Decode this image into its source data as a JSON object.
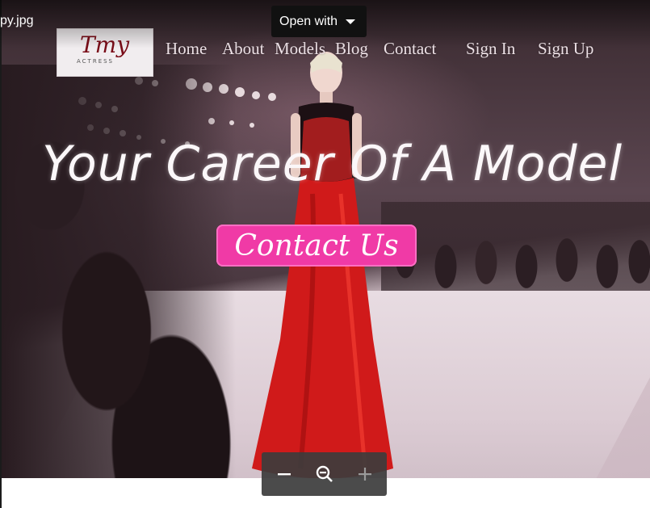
{
  "viewer": {
    "file_name": "py.jpg",
    "open_with_label": "Open with",
    "zoom_controls": [
      "zoom-out",
      "reset-zoom",
      "zoom-in"
    ]
  },
  "site": {
    "logo_text": "Tmy",
    "logo_subtext": "ACTRESS",
    "nav": [
      "Home",
      "About",
      "Models",
      "Blog",
      "Contact",
      "Sign In",
      "Sign Up"
    ],
    "hero_title": "Your Career Of A Model",
    "cta_label": "Contact Us",
    "colors": {
      "cta": "#f03aa6",
      "gown": "#d01a1a"
    }
  }
}
